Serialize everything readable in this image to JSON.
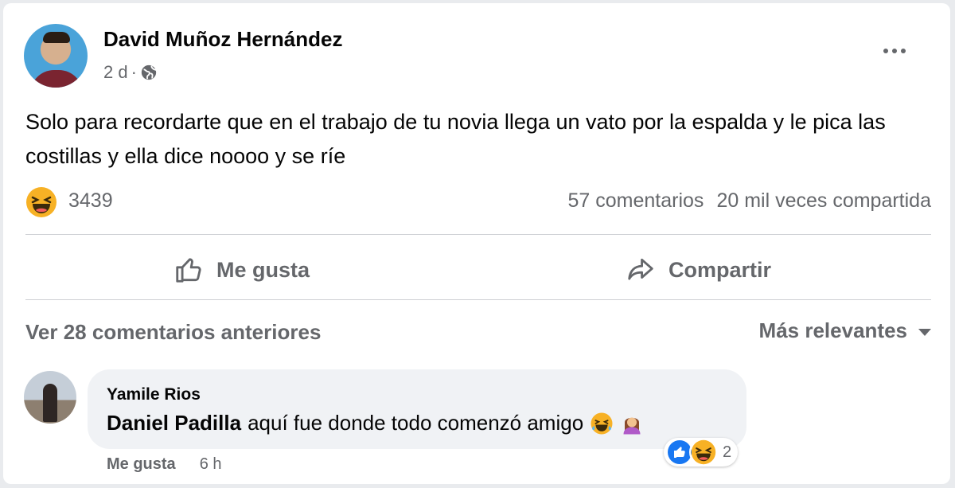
{
  "post": {
    "author": "David Muñoz Hernández",
    "time": "2 d",
    "separator": "·",
    "text": "Solo para recordarte que en el trabajo de tu novia llega un vato por la espalda y le pica las costillas y ella dice noooo y se ríe"
  },
  "stats": {
    "reaction_count": "3439",
    "comments": "57 comentarios",
    "shares": "20 mil veces compartida"
  },
  "actions": {
    "like": "Me gusta",
    "share": "Compartir"
  },
  "comments_header": {
    "previous": "Ver 28 comentarios anteriores",
    "sort": "Más relevantes"
  },
  "comment": {
    "author": "Yamile Rios",
    "mention": "Daniel Padilla",
    "text": "aquí fue donde todo comenzó amigo",
    "reaction_count": "2",
    "like_label": "Me gusta",
    "time": "6 h"
  },
  "colors": {
    "secondary_text": "#65676b",
    "bubble": "#f0f2f5",
    "like_blue": "#1877f2",
    "haha_yellow": "#f7b125"
  },
  "icons": [
    "globe-icon",
    "more-icon",
    "haha-icon",
    "like-outline-icon",
    "share-icon",
    "caret-down-icon",
    "like-reaction-icon",
    "woman-shrugging-icon"
  ]
}
